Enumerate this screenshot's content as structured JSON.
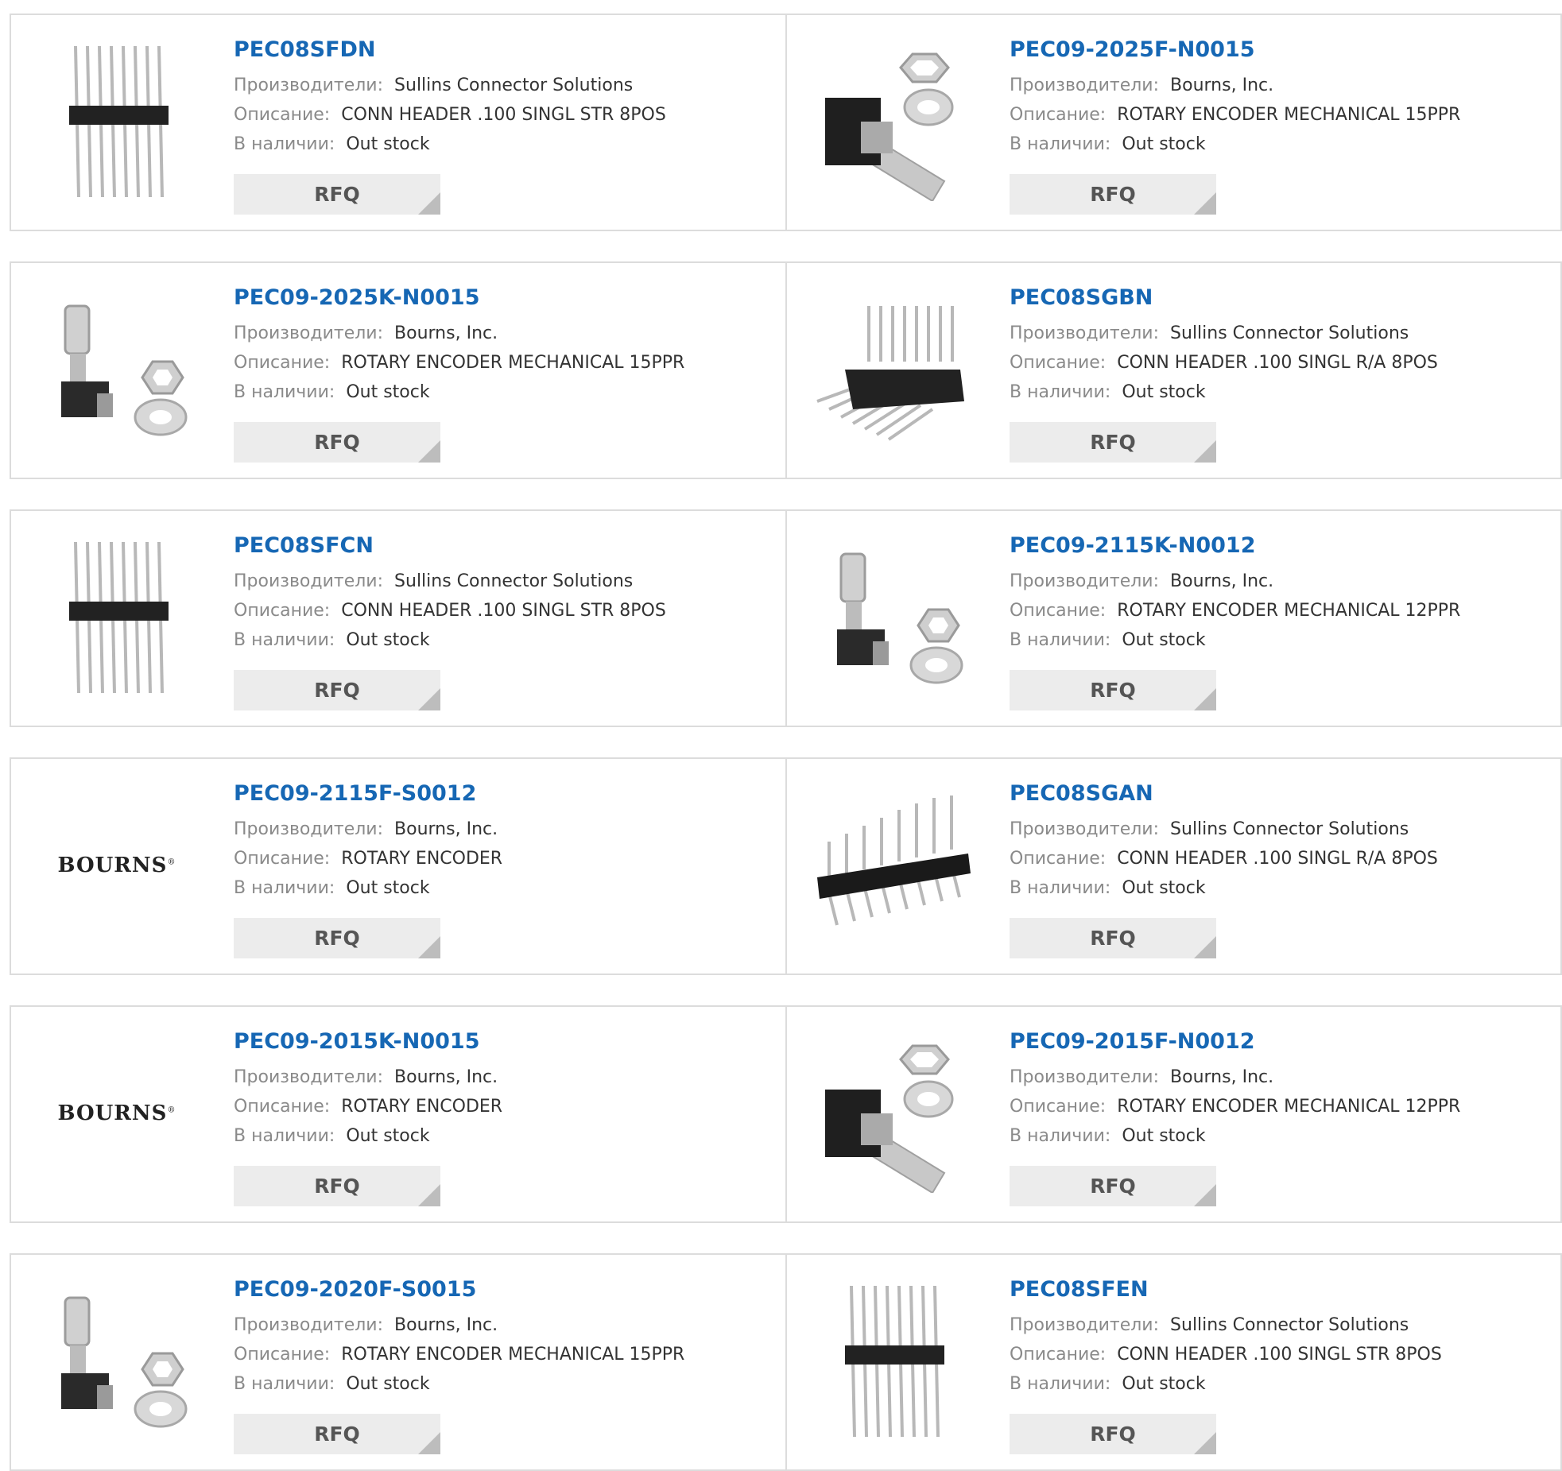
{
  "labels": {
    "manufacturer": "Производители:",
    "description": "Описание:",
    "stock": "В наличии:",
    "rfq": "RFQ"
  },
  "colors": {
    "part_link": "#1667b4",
    "label": "#8a8a8a",
    "button_bg": "#ececec"
  },
  "products": [
    {
      "part": "PEC08SFDN",
      "manufacturer": "Sullins Connector Solutions",
      "description": "CONN HEADER .100 SINGL STR 8POS",
      "stock": "Out stock",
      "image": "header-straight-icon"
    },
    {
      "part": "PEC09-2025F-N0015",
      "manufacturer": "Bourns, Inc.",
      "description": "ROTARY ENCODER MECHANICAL 15PPR",
      "stock": "Out stock",
      "image": "encoder-angled-icon"
    },
    {
      "part": "PEC09-2025K-N0015",
      "manufacturer": "Bourns, Inc.",
      "description": "ROTARY ENCODER MECHANICAL 15PPR",
      "stock": "Out stock",
      "image": "encoder-vertical-icon"
    },
    {
      "part": "PEC08SGBN",
      "manufacturer": "Sullins Connector Solutions",
      "description": "CONN HEADER .100 SINGL R/A 8POS",
      "stock": "Out stock",
      "image": "header-right-angle-icon"
    },
    {
      "part": "PEC08SFCN",
      "manufacturer": "Sullins Connector Solutions",
      "description": "CONN HEADER .100 SINGL STR 8POS",
      "stock": "Out stock",
      "image": "header-straight-icon"
    },
    {
      "part": "PEC09-2115K-N0012",
      "manufacturer": "Bourns, Inc.",
      "description": "ROTARY ENCODER MECHANICAL 12PPR",
      "stock": "Out stock",
      "image": "encoder-vertical-icon"
    },
    {
      "part": "PEC09-2115F-S0012",
      "manufacturer": "Bourns, Inc.",
      "description": "ROTARY ENCODER",
      "stock": "Out stock",
      "image": "bourns-logo",
      "logo_text": "BOURNS"
    },
    {
      "part": "PEC08SGAN",
      "manufacturer": "Sullins Connector Solutions",
      "description": "CONN HEADER .100 SINGL R/A 8POS",
      "stock": "Out stock",
      "image": "header-pcb-icon"
    },
    {
      "part": "PEC09-2015K-N0015",
      "manufacturer": "Bourns, Inc.",
      "description": "ROTARY ENCODER",
      "stock": "Out stock",
      "image": "bourns-logo",
      "logo_text": "BOURNS"
    },
    {
      "part": "PEC09-2015F-N0012",
      "manufacturer": "Bourns, Inc.",
      "description": "ROTARY ENCODER MECHANICAL 12PPR",
      "stock": "Out stock",
      "image": "encoder-angled-icon"
    },
    {
      "part": "PEC09-2020F-S0015",
      "manufacturer": "Bourns, Inc.",
      "description": "ROTARY ENCODER MECHANICAL 15PPR",
      "stock": "Out stock",
      "image": "encoder-vertical-icon"
    },
    {
      "part": "PEC08SFEN",
      "manufacturer": "Sullins Connector Solutions",
      "description": "CONN HEADER .100 SINGL STR 8POS",
      "stock": "Out stock",
      "image": "header-straight-icon"
    }
  ]
}
